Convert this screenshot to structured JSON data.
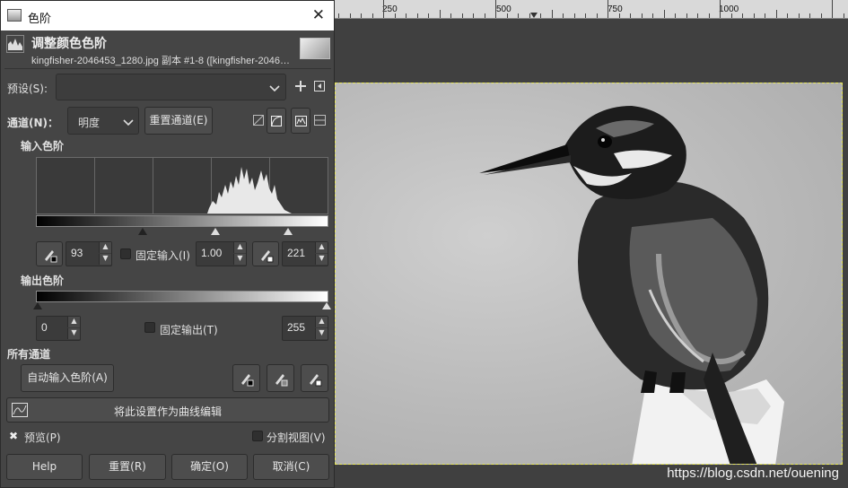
{
  "dialog": {
    "window_title": "色阶",
    "close_glyph": "✕",
    "header_title": "调整颜色色阶",
    "header_subtitle": "kingfisher-2046453_1280.jpg 副本 #1-8 ([kingfisher-2046…",
    "presets_label": "预设(S):",
    "presets_value": "",
    "channel_label": "通道(N)：",
    "channel_value": "明度",
    "reset_channel_label": "重置通道(E)",
    "input_levels_label": "输入色阶",
    "input_black": "93",
    "input_gamma": "1.00",
    "input_white": "221",
    "fixed_input_label": "固定输入(I)",
    "output_levels_label": "输出色阶",
    "output_black": "0",
    "output_white": "255",
    "fixed_output_label": "固定输出(T)",
    "all_channels_label": "所有通道",
    "auto_input_label": "自动输入色阶(A)",
    "curves_edit_label": "将此设置作为曲线编辑",
    "preview_label": "预览(P)",
    "preview_checked": true,
    "split_view_label": "分割视图(V)",
    "split_view_checked": false,
    "buttons": {
      "help": "Help",
      "reset": "重置(R)",
      "ok": "确定(O)",
      "cancel": "取消(C)"
    }
  },
  "ruler": {
    "labels": [
      "250",
      "500",
      "750",
      "1000"
    ]
  },
  "watermark": "https://blog.csdn.net/ouening",
  "colors": {
    "dialog_bg": "#454545",
    "canvas_bg": "#404040",
    "selection": "#e8e85a"
  }
}
